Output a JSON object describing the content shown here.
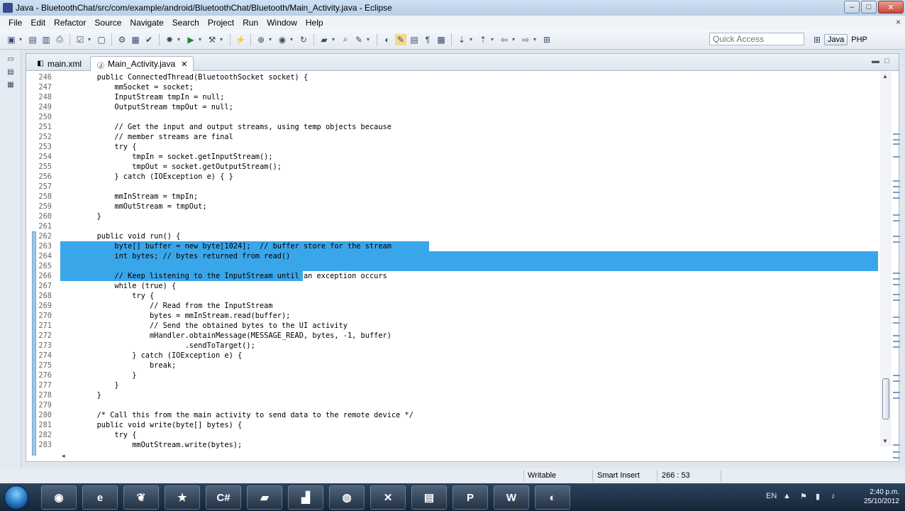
{
  "window": {
    "title": "Java - BluetoothChat/src/com/example/android/BluetoothChat/Bluetooth/Main_Activity.java - Eclipse",
    "minimize": "–",
    "maximize": "□",
    "close": "✕"
  },
  "menu": [
    "File",
    "Edit",
    "Refactor",
    "Source",
    "Navigate",
    "Search",
    "Project",
    "Run",
    "Window",
    "Help"
  ],
  "menu_close": "×",
  "toolbar": {
    "quick_access_placeholder": "Quick Access",
    "perspectives": [
      "Java",
      "PHP"
    ]
  },
  "tabs": [
    {
      "label": "main.xml",
      "active": false
    },
    {
      "label": "Main_Activity.java",
      "active": true
    }
  ],
  "tab_close": "✕",
  "code_lines": [
    {
      "n": "246",
      "text": "        public ConnectedThread(BluetoothSocket socket) {"
    },
    {
      "n": "247",
      "text": "            mmSocket = socket;"
    },
    {
      "n": "248",
      "text": "            InputStream tmpIn = null;"
    },
    {
      "n": "249",
      "text": "            OutputStream tmpOut = null;"
    },
    {
      "n": "250",
      "text": ""
    },
    {
      "n": "251",
      "text": "            // Get the input and output streams, using temp objects because"
    },
    {
      "n": "252",
      "text": "            // member streams are final"
    },
    {
      "n": "253",
      "text": "            try {"
    },
    {
      "n": "254",
      "text": "                tmpIn = socket.getInputStream();"
    },
    {
      "n": "255",
      "text": "                tmpOut = socket.getOutputStream();"
    },
    {
      "n": "256",
      "text": "            } catch (IOException e) { }"
    },
    {
      "n": "257",
      "text": ""
    },
    {
      "n": "258",
      "text": "            mmInStream = tmpIn;"
    },
    {
      "n": "259",
      "text": "            mmOutStream = tmpOut;"
    },
    {
      "n": "260",
      "text": "        }"
    },
    {
      "n": "261",
      "text": ""
    },
    {
      "n": "262",
      "text": "        public void run() {"
    },
    {
      "n": "263",
      "text": "            byte[] buffer = new byte[1024];  // buffer store for the stream"
    },
    {
      "n": "264",
      "text": "            int bytes; // bytes returned from read()"
    },
    {
      "n": "265",
      "text": ""
    },
    {
      "n": "266",
      "text": "            // Keep listening to the InputStream until an exception occurs"
    },
    {
      "n": "267",
      "text": "            while (true) {"
    },
    {
      "n": "268",
      "text": "                try {"
    },
    {
      "n": "269",
      "text": "                    // Read from the InputStream"
    },
    {
      "n": "270",
      "text": "                    bytes = mmInStream.read(buffer);"
    },
    {
      "n": "271",
      "text": "                    // Send the obtained bytes to the UI activity"
    },
    {
      "n": "272",
      "text": "                    mHandler.obtainMessage(MESSAGE_READ, bytes, -1, buffer)"
    },
    {
      "n": "273",
      "text": "                            .sendToTarget();"
    },
    {
      "n": "274",
      "text": "                } catch (IOException e) {"
    },
    {
      "n": "275",
      "text": "                    break;"
    },
    {
      "n": "276",
      "text": "                }"
    },
    {
      "n": "277",
      "text": "            }"
    },
    {
      "n": "278",
      "text": "        }"
    },
    {
      "n": "279",
      "text": ""
    },
    {
      "n": "280",
      "text": "        /* Call this from the main activity to send data to the remote device */"
    },
    {
      "n": "281",
      "text": "        public void write(byte[] bytes) {"
    },
    {
      "n": "282",
      "text": "            try {"
    },
    {
      "n": "283",
      "text": "                mmOutStream.write(bytes);"
    }
  ],
  "status": {
    "writable": "Writable",
    "insert_mode": "Smart Insert",
    "position": "266 : 53"
  },
  "taskbar": {
    "apps": [
      "chrome-icon",
      "ie-icon",
      "evernote-icon",
      "media-icon",
      "code-icon",
      "folder-icon",
      "chart-icon",
      "browser-icon",
      "xampp-icon",
      "explorer-icon",
      "powerpoint-icon",
      "word-icon",
      "eclipse-icon"
    ],
    "time": "2:40 p.m.",
    "date": "25/10/2012"
  },
  "colors": {
    "selection": "#3aa6ea",
    "title_bar": "#cfe0f2"
  }
}
